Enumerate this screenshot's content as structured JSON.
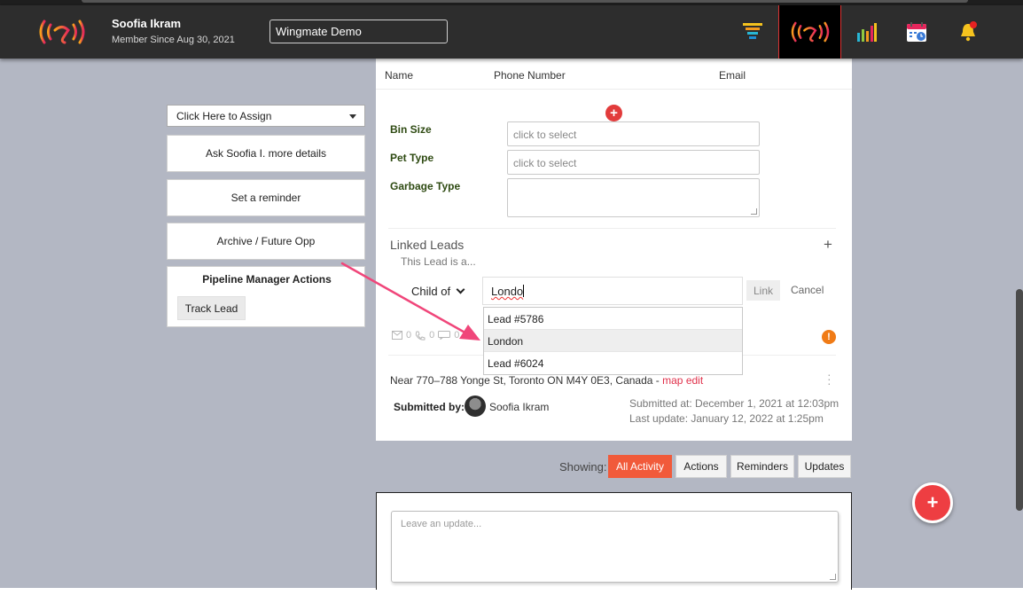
{
  "header": {
    "user_name": "Soofia Ikram",
    "member_since": "Member Since Aug 30, 2021",
    "org_value": "Wingmate Demo"
  },
  "icons": {
    "logo": "signal-logo-icon",
    "funnel": "funnel-icon",
    "signal": "signal-broadcast-icon",
    "chart": "bar-chart-icon",
    "calendar": "calendar-icon",
    "bell": "bell-icon"
  },
  "colors": {
    "header_bg": "#2d2d2d",
    "page_bg": "#b3b7c3",
    "accent": "#f15a3a",
    "link": "#e0304a",
    "label_green": "#2e4a12",
    "warning": "#f07b16"
  },
  "left_panel": {
    "assign_select": "Click Here to Assign",
    "ask_button": "Ask Soofia I. more details",
    "reminder_button": "Set a reminder",
    "archive_button": "Archive / Future Opp",
    "pipeline_title": "Pipeline Manager Actions",
    "track_button": "Track Lead"
  },
  "card": {
    "columns": [
      "Name",
      "Phone Number",
      "Email"
    ],
    "fields": [
      {
        "label": "Bin Size",
        "placeholder": "click to select"
      },
      {
        "label": "Pet Type",
        "placeholder": "click to select"
      },
      {
        "label": "Garbage Type",
        "placeholder": ""
      }
    ],
    "linked_leads": {
      "title": "Linked Leads",
      "plus": "+",
      "subtitle": "This Lead is a...",
      "relation": "Child of",
      "search_value": "Londo",
      "link_button": "Link",
      "cancel_button": "Cancel",
      "suggestions": [
        "Lead #5786",
        "London",
        "Lead #6024"
      ]
    },
    "meta_counts": [
      "0",
      "0",
      "0"
    ],
    "address_text": "Near 770–788 Yonge St, Toronto ON M4Y 0E3, Canada -",
    "map_link": "map",
    "edit_link": "edit",
    "submitted_by_label": "Submitted by:",
    "submitter_name": "Soofia Ikram",
    "submitted_at": "Submitted at: December 1, 2021 at 12:03pm",
    "last_update": "Last update: January 12, 2022 at 1:25pm"
  },
  "activity": {
    "showing_label": "Showing:",
    "filters": [
      "All Activity",
      "Actions",
      "Reminders",
      "Updates"
    ],
    "active_filter": "All Activity",
    "update_placeholder": "Leave an update..."
  },
  "fab_label": "+"
}
